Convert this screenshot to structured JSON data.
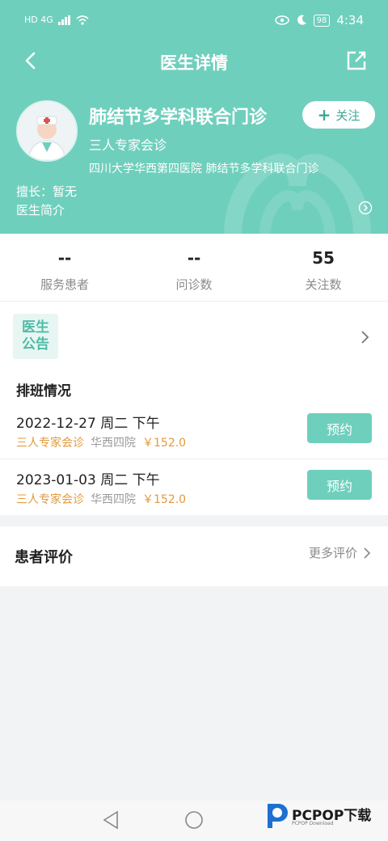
{
  "status_bar": {
    "network_left": "HD 4G",
    "battery": "98",
    "time": "4:34"
  },
  "header": {
    "title": "医生详情"
  },
  "doctor": {
    "name": "肺结节多学科联合门诊",
    "follow_label": "关注",
    "type": "三人专家会诊",
    "hospital": "四川大学华西第四医院  肺结节多学科联合门诊",
    "specialty": "擅长：暂无",
    "intro_label": "医生简介"
  },
  "stats": [
    {
      "value": "--",
      "label": "服务患者"
    },
    {
      "value": "--",
      "label": "问诊数"
    },
    {
      "value": "55",
      "label": "关注数"
    }
  ],
  "notice": {
    "line1": "医生",
    "line2": "公告"
  },
  "schedule": {
    "title": "排班情况",
    "rows": [
      {
        "datetime": "2022-12-27  周二  下午",
        "type": "三人专家会诊",
        "hospital": "华西四院",
        "price": "￥152.0",
        "button": "预约"
      },
      {
        "datetime": "2023-01-03  周二  下午",
        "type": "三人专家会诊",
        "hospital": "华西四院",
        "price": "￥152.0",
        "button": "预约"
      }
    ]
  },
  "reviews": {
    "title": "患者评价",
    "more_label": "更多评价"
  },
  "watermark": {
    "brand": "PCPOP下载",
    "sub": "PCPOP Download"
  },
  "colors": {
    "primary": "#6fcfbd",
    "accent_orange": "#e39a3c"
  }
}
